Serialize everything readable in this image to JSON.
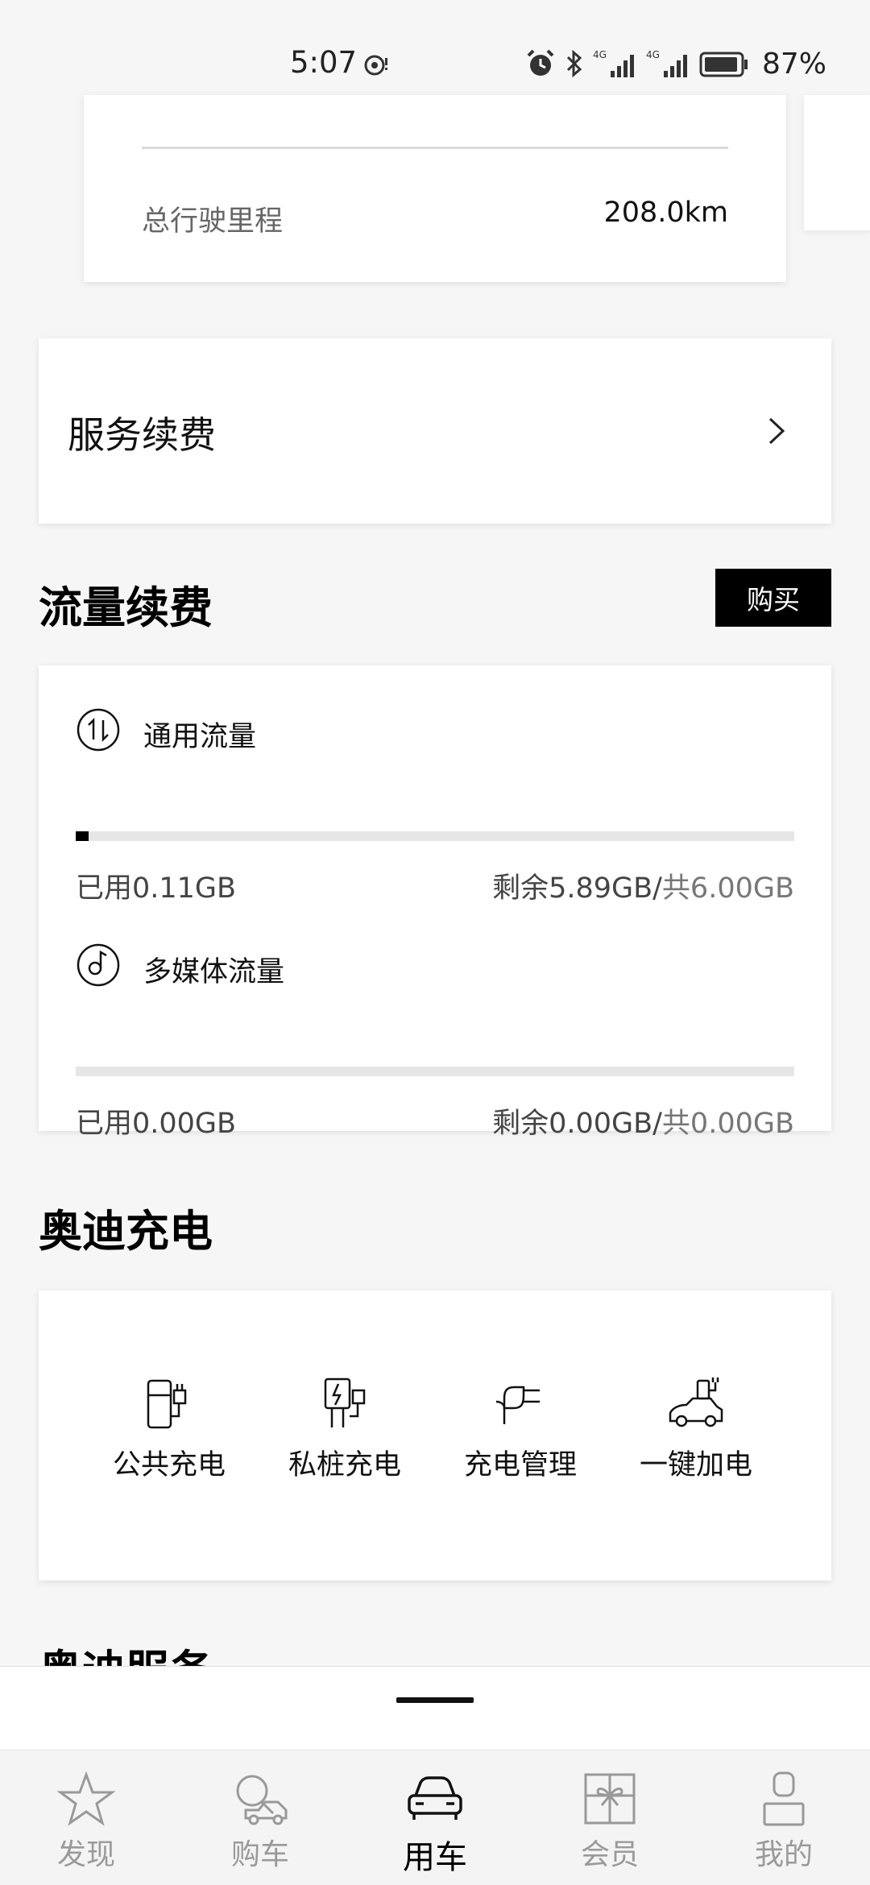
{
  "status_bar": {
    "time": "5:07",
    "battery_percent": "87%"
  },
  "top_card": {
    "mileage_label": "总行驶里程",
    "mileage_value": "208.0km"
  },
  "service": {
    "title": "服务续费"
  },
  "traffic": {
    "section_title": "流量续费",
    "buy_label": "购买",
    "items": [
      {
        "name": "通用流量",
        "used": "已用0.11GB",
        "remain": "剩余5.89GB/",
        "total": "共6.00GB",
        "used_fraction": 0.018
      },
      {
        "name": "多媒体流量",
        "used": "已用0.00GB",
        "remain": "剩余0.00GB/",
        "total": "共0.00GB",
        "used_fraction": 0
      }
    ]
  },
  "charging": {
    "section_title": "奥迪充电",
    "items": [
      {
        "label": "公共充电",
        "icon": "public-charger-icon"
      },
      {
        "label": "私桩充电",
        "icon": "private-charger-icon"
      },
      {
        "label": "充电管理",
        "icon": "plug-icon"
      },
      {
        "label": "一键加电",
        "icon": "car-charge-icon"
      }
    ]
  },
  "next_section": {
    "title": "奥迪服务"
  },
  "tabbar": {
    "items": [
      {
        "label": "发现",
        "icon": "star-icon"
      },
      {
        "label": "购车",
        "icon": "buy-car-icon"
      },
      {
        "label": "用车",
        "icon": "car-icon",
        "active": true
      },
      {
        "label": "会员",
        "icon": "gift-icon"
      },
      {
        "label": "我的",
        "icon": "user-icon"
      }
    ]
  }
}
